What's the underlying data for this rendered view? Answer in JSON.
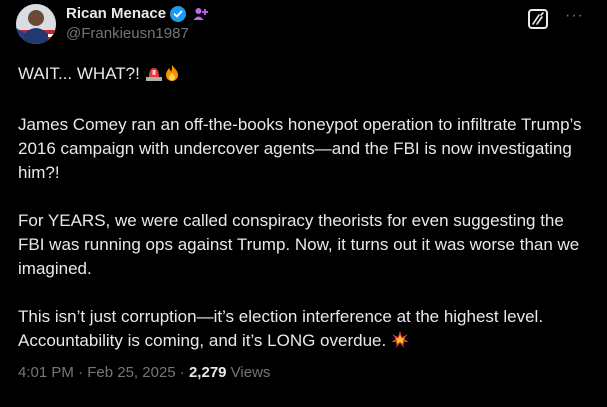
{
  "author": {
    "name": "Rican Menace",
    "handle": "@Frankieusn1987",
    "verified_color": "#1d9bf0",
    "affiliate_color": "#c264f0"
  },
  "icons": {
    "avatar": "avatar",
    "verified": "verified-badge-icon",
    "affiliate": "affiliate-badge-icon",
    "grok": "grok-icon",
    "more": "more-icon"
  },
  "tweet": {
    "line1": "WAIT... WHAT?! ",
    "p2": "James Comey ran an off-the-books honeypot operation to infiltrate Trump’s 2016 campaign with undercover agents—and the FBI is now investigating him?!",
    "p3": "For YEARS, we were called conspiracy theorists for even suggesting the FBI was running ops against Trump. Now, it turns out it was worse than we imagined.",
    "p4": "This isn’t just corruption—it’s election interference at the highest level. Accountability is coming, and it’s LONG overdue. "
  },
  "meta": {
    "time": "4:01 PM",
    "sep1": " · ",
    "date": "Feb 25, 2025",
    "sep2": " · ",
    "views_count": "2,279",
    "views_label": " Views"
  },
  "more_label": "···"
}
